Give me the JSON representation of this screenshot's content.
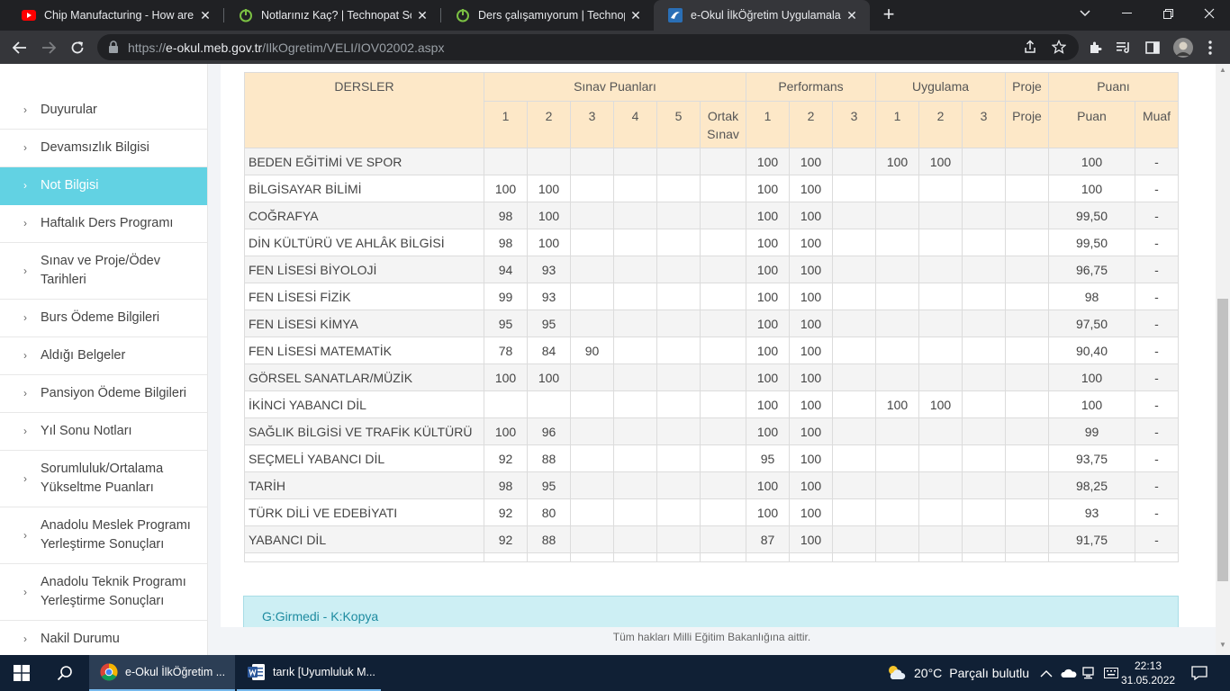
{
  "browser": {
    "tabs": [
      {
        "title": "Chip Manufacturing - How are M",
        "icon": "youtube-icon",
        "active": false
      },
      {
        "title": "Notlarınız Kaç? | Technopat Sosya",
        "icon": "technopat-icon",
        "active": false
      },
      {
        "title": "Ders çalışamıyorum | Technopat S",
        "icon": "technopat-icon",
        "active": false
      },
      {
        "title": "e-Okul İlkÖğretim Uygulamaları",
        "icon": "eokul-icon",
        "active": true
      }
    ],
    "url_host": "e-okul.meb.gov.tr",
    "url_prefix": "https://",
    "url_path": "/IlkOgretim/VELI/IOV02002.aspx"
  },
  "sidebar": {
    "items": [
      {
        "label": "Duyurular",
        "active": false
      },
      {
        "label": "Devamsızlık Bilgisi",
        "active": false
      },
      {
        "label": "Not Bilgisi",
        "active": true
      },
      {
        "label": "Haftalık Ders Programı",
        "active": false
      },
      {
        "label": "Sınav ve Proje/Ödev Tarihleri",
        "active": false
      },
      {
        "label": "Burs Ödeme Bilgileri",
        "active": false
      },
      {
        "label": "Aldığı Belgeler",
        "active": false
      },
      {
        "label": "Pansiyon Ödeme Bilgileri",
        "active": false
      },
      {
        "label": "Yıl Sonu Notları",
        "active": false
      },
      {
        "label": "Sorumluluk/Ortalama Yükseltme Puanları",
        "active": false
      },
      {
        "label": "Anadolu Meslek Programı Yerleştirme Sonuçları",
        "active": false
      },
      {
        "label": "Anadolu Teknik Programı Yerleştirme Sonuçları",
        "active": false
      },
      {
        "label": "Nakil Durumu",
        "active": false
      }
    ]
  },
  "grades": {
    "header_groups": {
      "dersler": "DERSLER",
      "sinav": "Sınav Puanları",
      "performans": "Performans",
      "uygulama": "Uygulama",
      "proje": "Proje",
      "puani": "Puanı"
    },
    "sub_headers": [
      "1",
      "2",
      "3",
      "4",
      "5",
      "Ortak Sınav",
      "1",
      "2",
      "3",
      "1",
      "2",
      "3",
      "Proje",
      "Puan",
      "Muaf"
    ],
    "rows": [
      [
        "BEDEN EĞİTİMİ VE SPOR",
        "",
        "",
        "",
        "",
        "",
        "",
        "100",
        "100",
        "",
        "100",
        "100",
        "",
        "",
        "100",
        "-"
      ],
      [
        "BİLGİSAYAR BİLİMİ",
        "100",
        "100",
        "",
        "",
        "",
        "",
        "100",
        "100",
        "",
        "",
        "",
        "",
        "",
        "100",
        "-"
      ],
      [
        "COĞRAFYA",
        "98",
        "100",
        "",
        "",
        "",
        "",
        "100",
        "100",
        "",
        "",
        "",
        "",
        "",
        "99,50",
        "-"
      ],
      [
        "DİN KÜLTÜRÜ VE AHLÂK BİLGİSİ",
        "98",
        "100",
        "",
        "",
        "",
        "",
        "100",
        "100",
        "",
        "",
        "",
        "",
        "",
        "99,50",
        "-"
      ],
      [
        "FEN LİSESİ BİYOLOJİ",
        "94",
        "93",
        "",
        "",
        "",
        "",
        "100",
        "100",
        "",
        "",
        "",
        "",
        "",
        "96,75",
        "-"
      ],
      [
        "FEN LİSESİ FİZİK",
        "99",
        "93",
        "",
        "",
        "",
        "",
        "100",
        "100",
        "",
        "",
        "",
        "",
        "",
        "98",
        "-"
      ],
      [
        "FEN LİSESİ KİMYA",
        "95",
        "95",
        "",
        "",
        "",
        "",
        "100",
        "100",
        "",
        "",
        "",
        "",
        "",
        "97,50",
        "-"
      ],
      [
        "FEN LİSESİ MATEMATİK",
        "78",
        "84",
        "90",
        "",
        "",
        "",
        "100",
        "100",
        "",
        "",
        "",
        "",
        "",
        "90,40",
        "-"
      ],
      [
        "GÖRSEL SANATLAR/MÜZİK",
        "100",
        "100",
        "",
        "",
        "",
        "",
        "100",
        "100",
        "",
        "",
        "",
        "",
        "",
        "100",
        "-"
      ],
      [
        "İKİNCİ YABANCI DİL",
        "",
        "",
        "",
        "",
        "",
        "",
        "100",
        "100",
        "",
        "100",
        "100",
        "",
        "",
        "100",
        "-"
      ],
      [
        "SAĞLIK BİLGİSİ VE TRAFİK KÜLTÜRÜ",
        "100",
        "96",
        "",
        "",
        "",
        "",
        "100",
        "100",
        "",
        "",
        "",
        "",
        "",
        "99",
        "-"
      ],
      [
        "SEÇMELİ YABANCI DİL",
        "92",
        "88",
        "",
        "",
        "",
        "",
        "95",
        "100",
        "",
        "",
        "",
        "",
        "",
        "93,75",
        "-"
      ],
      [
        "TARİH",
        "98",
        "95",
        "",
        "",
        "",
        "",
        "100",
        "100",
        "",
        "",
        "",
        "",
        "",
        "98,25",
        "-"
      ],
      [
        "TÜRK DİLİ VE EDEBİYATI",
        "92",
        "80",
        "",
        "",
        "",
        "",
        "100",
        "100",
        "",
        "",
        "",
        "",
        "",
        "93",
        "-"
      ],
      [
        "YABANCI DİL",
        "92",
        "88",
        "",
        "",
        "",
        "",
        "87",
        "100",
        "",
        "",
        "",
        "",
        "",
        "91,75",
        "-"
      ]
    ]
  },
  "legend_text": "G:Girmedi - K:Kopya",
  "footer_text": "Tüm hakları Milli Eğitim Bakanlığına aittir.",
  "taskbar": {
    "apps": [
      {
        "label": "e-Okul İlkÖğretim ...",
        "icon": "chrome-icon"
      },
      {
        "label": "tarık [Uyumluluk M...",
        "icon": "word-icon"
      }
    ],
    "weather_temp": "20°C",
    "weather_desc": "Parçalı bulutlu",
    "time": "22:13",
    "date": "31.05.2022"
  },
  "colors": {
    "active_menu": "#62d2e3",
    "table_header": "#fde8c8",
    "legend_bg": "#cdeff4"
  }
}
